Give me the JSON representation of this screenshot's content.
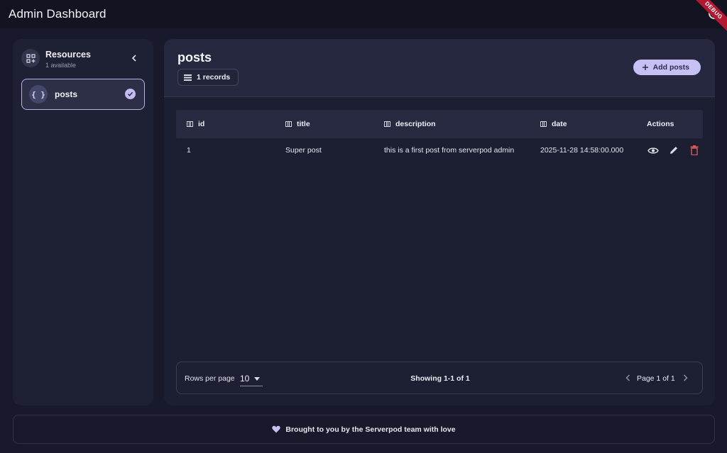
{
  "appbar": {
    "title": "Admin Dashboard",
    "theme_icon": "theme-toggle-icon",
    "debug_banner": "DEBUG"
  },
  "sidebar": {
    "title": "Resources",
    "subtitle": "1 available",
    "items": [
      {
        "label": "posts",
        "icon": "braces-icon",
        "icon_glyph": "{ }",
        "selected": true
      }
    ]
  },
  "main": {
    "title": "posts",
    "records_chip": "1 records",
    "add_button": "Add posts",
    "table": {
      "columns": [
        "id",
        "title",
        "description",
        "date",
        "Actions"
      ],
      "rows": [
        {
          "id": "1",
          "title": "Super post",
          "description": "this is a first post from serverpod admin",
          "date": "2025-11-28 14:58:00.000"
        }
      ],
      "row_actions": [
        "view-icon",
        "edit-icon",
        "delete-icon"
      ]
    },
    "pagination": {
      "rows_per_page_label": "Rows per page",
      "rows_per_page_value": "10",
      "showing": "Showing 1-1 of 1",
      "page_label": "Page 1 of 1"
    }
  },
  "footer": {
    "text": "Brought to you by the Serverpod team with love"
  },
  "colors": {
    "accent": "#c7c1f3",
    "background": "#181a2c",
    "panel": "#1c1e31",
    "delete": "#e0585c",
    "debug_ribbon": "#b5172f"
  }
}
